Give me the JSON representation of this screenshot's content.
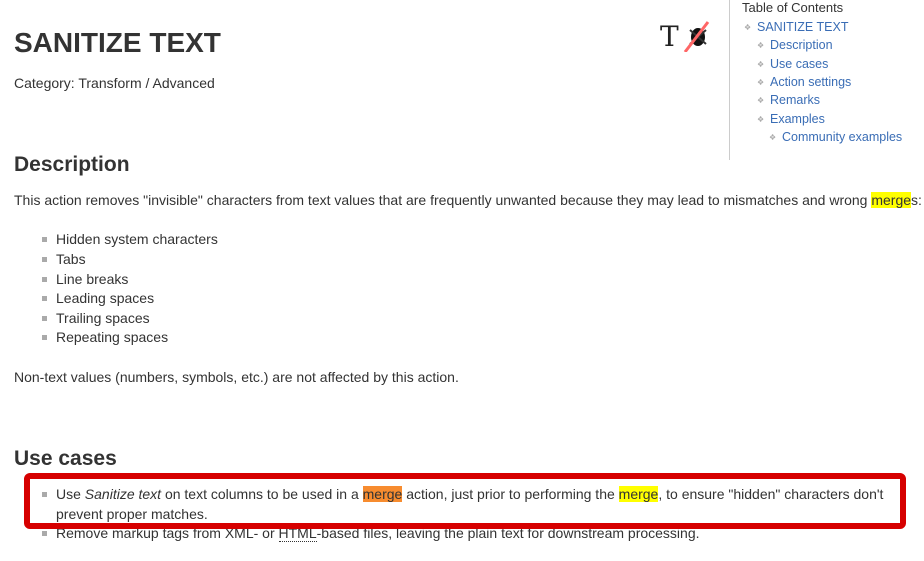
{
  "title": "SANITIZE TEXT",
  "category": "Category: Transform / Advanced",
  "logo": {
    "letter": "T",
    "icon": "sanitize-bug-icon",
    "accent": "#ff6666"
  },
  "toc": {
    "title": "Table of Contents",
    "items": [
      {
        "label": "SANITIZE TEXT",
        "level": 1
      },
      {
        "label": "Description",
        "level": 2
      },
      {
        "label": "Use cases",
        "level": 2
      },
      {
        "label": "Action settings",
        "level": 2
      },
      {
        "label": "Remarks",
        "level": 2
      },
      {
        "label": "Examples",
        "level": 2
      },
      {
        "label": "Community examples",
        "level": 3
      }
    ]
  },
  "description": {
    "heading": "Description",
    "intro_before": "This action removes \"invisible\" characters from text values that are frequently unwanted because they may lead to mismatches and wrong ",
    "intro_highlight": "merge",
    "intro_after": "s:",
    "items": [
      "Hidden system characters",
      "Tabs",
      "Line breaks",
      "Leading spaces",
      "Trailing spaces",
      "Repeating spaces"
    ],
    "note": "Non-text values (numbers, symbols, etc.) are not affected by this action."
  },
  "use_cases": {
    "heading": "Use cases",
    "item1": {
      "a": "Use ",
      "em": "Sanitize text",
      "b": " on text columns to be used in a ",
      "h1": "merge",
      "c": " action, just prior to performing the ",
      "h2": "merge",
      "d": ", to ensure \"hidden\" characters don't",
      "line2": "prevent proper matches."
    },
    "item2": {
      "a": "Remove markup tags from XML- or ",
      "abbr": "HTML",
      "b": "-based files, leaving the plain text for downstream processing."
    }
  },
  "colors": {
    "highlight_yellow": "#ffff00",
    "highlight_orange": "#f78c2f",
    "annotation_box": "#d60000",
    "link": "#3a6db5"
  }
}
